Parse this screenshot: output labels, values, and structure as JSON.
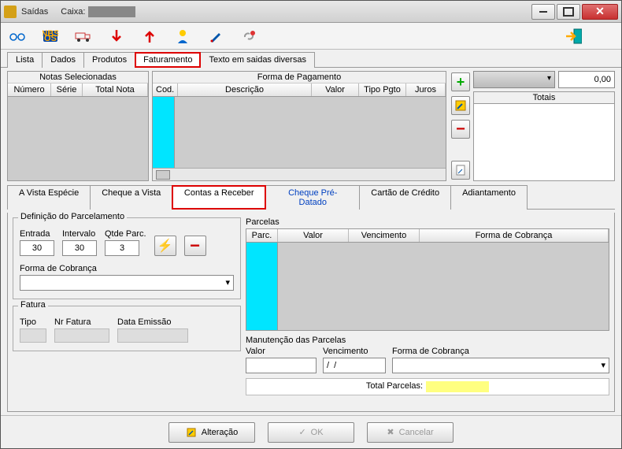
{
  "window": {
    "title": "Saídas",
    "caixa_label": "Caixa:"
  },
  "toolbar_icons": [
    "glasses",
    "nbs",
    "truck",
    "arrow-down",
    "arrow-up",
    "person",
    "pen",
    "link",
    "exit"
  ],
  "main_tabs": [
    "Lista",
    "Dados",
    "Produtos",
    "Faturamento",
    "Texto em saidas diversas"
  ],
  "main_tab_active": 3,
  "notas": {
    "title": "Notas Selecionadas",
    "cols": [
      "Número",
      "Série",
      "Total Nota"
    ]
  },
  "forma_pag": {
    "title": "Forma de Pagamento",
    "cols": [
      "Cod.",
      "Descrição",
      "Valor",
      "Tipo Pgto",
      "Juros"
    ]
  },
  "right": {
    "value": "0,00",
    "totais_label": "Totais"
  },
  "pay_tabs": [
    "A Vista Espécie",
    "Cheque a Vista",
    "Contas a Receber",
    "Cheque Pré-Datado",
    "Cartão de Crédito",
    "Adiantamento"
  ],
  "pay_tab_active": 2,
  "parcelamento": {
    "legend": "Definição do Parcelamento",
    "entrada_label": "Entrada",
    "entrada": "30",
    "intervalo_label": "Intervalo",
    "intervalo": "30",
    "qtde_label": "Qtde Parc.",
    "qtde": "3",
    "forma_label": "Forma de Cobrança"
  },
  "fatura": {
    "legend": "Fatura",
    "tipo_label": "Tipo",
    "nr_label": "Nr Fatura",
    "data_label": "Data Emissão"
  },
  "parcelas": {
    "legend": "Parcelas",
    "cols": [
      "Parc.",
      "Valor",
      "Vencimento",
      "Forma de Cobrança"
    ],
    "maint_label": "Manutenção das Parcelas",
    "valor_label": "Valor",
    "venc_label": "Vencimento",
    "venc_value": "/  /",
    "forma_label": "Forma de Cobrança",
    "total_label": "Total Parcelas:"
  },
  "footer": {
    "alteracao": "Alteração",
    "ok": "OK",
    "cancelar": "Cancelar"
  }
}
